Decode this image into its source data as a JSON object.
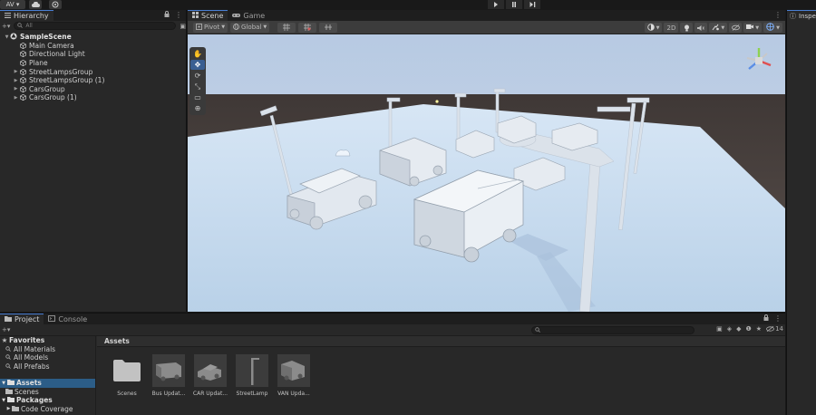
{
  "toolbar": {
    "account_label": "AV ▾",
    "play_icon": "play-icon",
    "pause_icon": "pause-icon",
    "step_icon": "step-icon"
  },
  "hierarchy": {
    "tab_label": "Hierarchy",
    "search_placeholder": "All",
    "scene_name": "SampleScene",
    "items": [
      {
        "label": "Main Camera",
        "expandable": false
      },
      {
        "label": "Directional Light",
        "expandable": false
      },
      {
        "label": "Plane",
        "expandable": false
      },
      {
        "label": "StreetLampsGroup",
        "expandable": true
      },
      {
        "label": "StreetLampsGroup (1)",
        "expandable": true
      },
      {
        "label": "CarsGroup",
        "expandable": true
      },
      {
        "label": "CarsGroup (1)",
        "expandable": true
      }
    ]
  },
  "scene_view": {
    "tabs": [
      {
        "label": "Scene",
        "icon": "grid-icon",
        "active": true
      },
      {
        "label": "Game",
        "icon": "gamepad-icon",
        "active": false
      }
    ],
    "pivot_label": "Pivot",
    "global_label": "Global",
    "mode_2d_label": "2D",
    "tools": [
      "hand-tool",
      "move-tool",
      "rotate-tool",
      "scale-tool",
      "rect-tool",
      "transform-tool"
    ],
    "active_tool": "move-tool"
  },
  "inspector": {
    "tab_label": "Inspe"
  },
  "project": {
    "tabs": [
      {
        "label": "Project",
        "icon": "folder-icon",
        "active": true
      },
      {
        "label": "Console",
        "icon": "console-icon",
        "active": false
      }
    ],
    "hidden_count": "14",
    "sidebar": {
      "favorites_label": "Favorites",
      "favorites": [
        "All Materials",
        "All Models",
        "All Prefabs"
      ],
      "assets_label": "Assets",
      "assets_children": [
        "Scenes"
      ],
      "packages_label": "Packages",
      "packages_children": [
        "Code Coverage"
      ]
    },
    "assets_header": "Assets",
    "assets": [
      {
        "label": "Scenes",
        "kind": "folder-icon"
      },
      {
        "label": "Bus Updat...",
        "kind": "bus-model-icon"
      },
      {
        "label": "CAR Updat...",
        "kind": "car-model-icon"
      },
      {
        "label": "StreetLamp",
        "kind": "lamp-model-icon"
      },
      {
        "label": "VAN Upda...",
        "kind": "van-model-icon"
      }
    ]
  }
}
